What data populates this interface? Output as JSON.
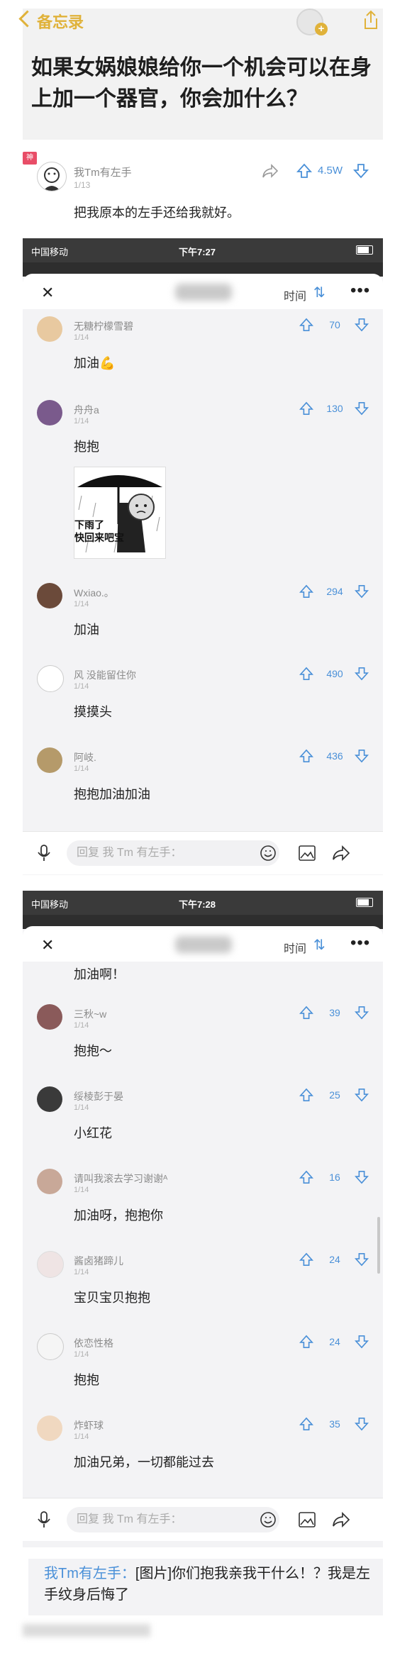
{
  "header": {
    "back_label": "备忘录",
    "question": "如果女娲娘娘给你一个机会可以在身上加一个器官，你会加什么？"
  },
  "top_answer": {
    "badge": "神",
    "author": "我Tm有左手",
    "date": "1/13",
    "votes": "4.5W",
    "text": "把我原本的左手还给我就好。"
  },
  "shot1": {
    "status": {
      "carrier": "中国移动",
      "time": "下午7:27"
    },
    "sort_label": "时间",
    "comments": [
      {
        "name": "无糖柠檬雪碧",
        "date": "1/14",
        "votes": "70",
        "text": "加油💪"
      },
      {
        "name": "舟舟a",
        "date": "1/14",
        "votes": "130",
        "text": "抱抱",
        "meme": "下雨了\n快回来吧宝"
      },
      {
        "name": "Wxiao.。",
        "date": "1/14",
        "votes": "294",
        "text": "加油"
      },
      {
        "name": "风 没能留住你",
        "date": "1/14",
        "votes": "490",
        "text": "摸摸头"
      },
      {
        "name": "阿岐.",
        "date": "1/14",
        "votes": "436",
        "text": "抱抱加油加油"
      }
    ],
    "reply_placeholder": "回复 我 Tm 有左手："
  },
  "shot2": {
    "status": {
      "carrier": "中国移动",
      "time": "下午7:28"
    },
    "sort_label": "时间",
    "partial_text": "加油啊！",
    "comments": [
      {
        "name": "三秋~w",
        "date": "1/14",
        "votes": "39",
        "text": "抱抱～"
      },
      {
        "name": "绥棱彭于晏",
        "date": "1/14",
        "votes": "25",
        "text": "小红花"
      },
      {
        "name": "请叫我滚去学习谢谢ᴬ",
        "date": "1/14",
        "votes": "16",
        "text": "加油呀，抱抱你"
      },
      {
        "name": "酱卤猪蹄儿",
        "date": "1/14",
        "votes": "24",
        "text": "宝贝宝贝抱抱"
      },
      {
        "name": "依恋性格",
        "date": "1/14",
        "votes": "24",
        "text": "抱抱"
      },
      {
        "name": "炸虾球",
        "date": "1/14",
        "votes": "35",
        "text": "加油兄弟，一切都能过去"
      }
    ],
    "reply_placeholder": "回复 我 Tm 有左手："
  },
  "footer": {
    "author": "我Tm有左手：",
    "text": "[图片]你们抱我亲我干什么！？我是左手纹身后悔了"
  },
  "colors": {
    "accent": "#4a90d8",
    "brand_yellow": "#e0b23a",
    "badge_red": "#e84d67"
  }
}
